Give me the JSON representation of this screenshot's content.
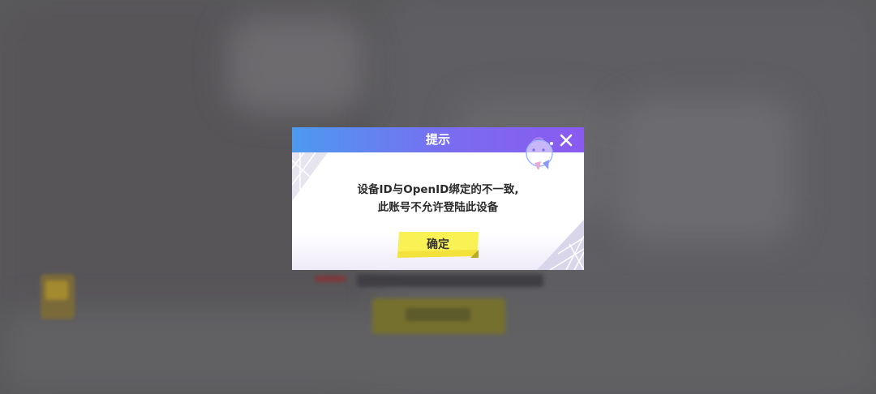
{
  "dialog": {
    "title": "提示",
    "message_line1": "设备ID与OpenID绑定的不一致,",
    "message_line2": "此账号不允许登陆此设备",
    "confirm_label": "确定",
    "close_icon": "close-icon",
    "mascot_icon": "mascot-icon"
  },
  "colors": {
    "header_start": "#4d9af0",
    "header_end": "#8a5af0",
    "button_yellow": "#f7ee4a",
    "overlay": "#5a5a5c"
  }
}
